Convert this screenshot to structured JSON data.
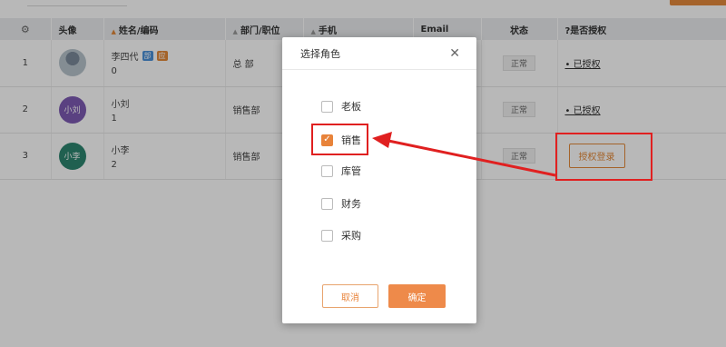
{
  "table": {
    "headers": {
      "settings_icon": "gear-icon",
      "avatar": "头像",
      "name": "姓名/编码",
      "dept": "部门/职位",
      "phone": "手机",
      "email": "Email",
      "status": "状态",
      "auth": "?是否授权"
    },
    "rows": [
      {
        "num": "1",
        "name": "李四代",
        "tag1": "部",
        "tag2": "应",
        "code": "0",
        "dept": "总 部",
        "status": "正常",
        "auth": "• 已授权"
      },
      {
        "num": "2",
        "avatar_text": "小刘",
        "name": "小刘",
        "code": "1",
        "dept": "销售部",
        "status": "正常",
        "auth": "• 已授权"
      },
      {
        "num": "3",
        "avatar_text": "小李",
        "name": "小李",
        "code": "2",
        "dept": "销售部",
        "status": "正常",
        "auth_button": "授权登录"
      }
    ]
  },
  "dialog": {
    "title": "选择角色",
    "close_icon": "close-icon",
    "options": [
      {
        "label": "老板",
        "checked": false
      },
      {
        "label": "销售",
        "checked": true
      },
      {
        "label": "库管",
        "checked": false
      },
      {
        "label": "财务",
        "checked": false
      },
      {
        "label": "采购",
        "checked": false
      }
    ],
    "cancel_label": "取消",
    "ok_label": "确定"
  },
  "colors": {
    "accent": "#e8833a",
    "annotation_red": "#e02020"
  }
}
